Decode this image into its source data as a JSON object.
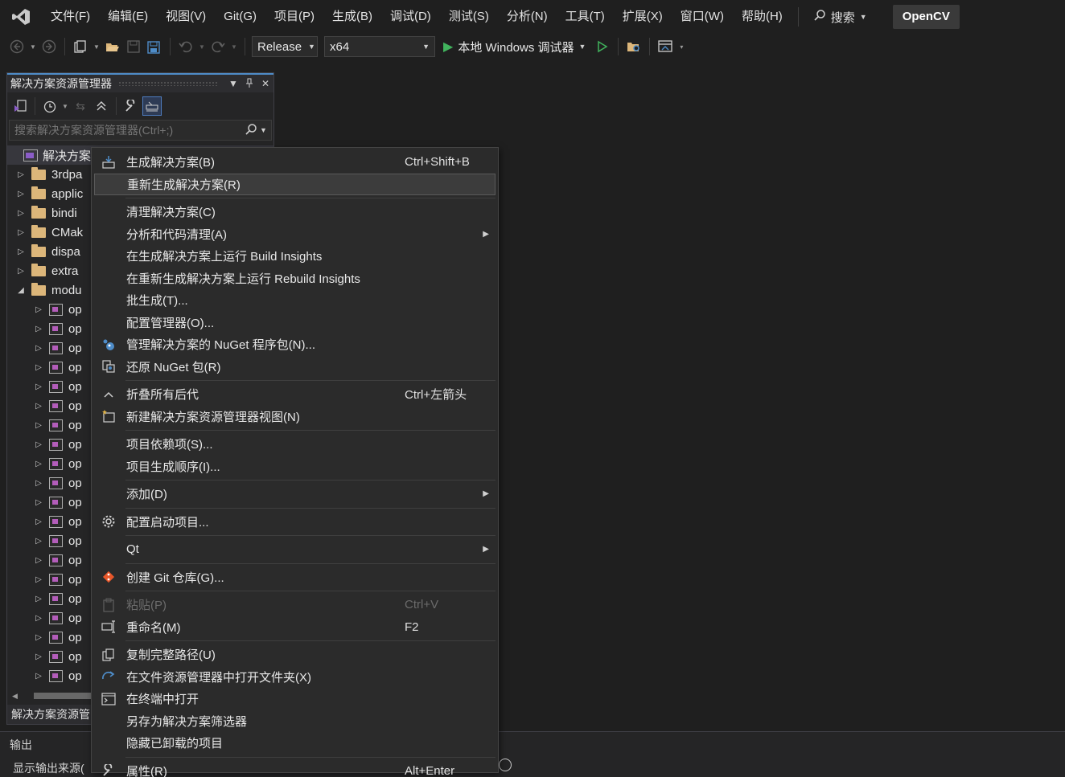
{
  "menubar": {
    "items": [
      "文件(F)",
      "编辑(E)",
      "视图(V)",
      "Git(G)",
      "项目(P)",
      "生成(B)",
      "调试(D)",
      "测试(S)",
      "分析(N)",
      "工具(T)",
      "扩展(X)",
      "窗口(W)",
      "帮助(H)"
    ],
    "search_label": "搜索",
    "solution_name": "OpenCV"
  },
  "toolbar": {
    "configuration": "Release",
    "platform": "x64",
    "run_label": "本地 Windows 调试器"
  },
  "solution_explorer": {
    "title": "解决方案资源管理器",
    "search_placeholder": "搜索解决方案资源管理器(Ctrl+;)",
    "root_label": "解决方案",
    "folders": [
      "3rdpa",
      "applic",
      "bindi",
      "CMak",
      "dispa",
      "extra",
      "modu"
    ],
    "project_label": "op",
    "project_count": 20,
    "bottom_tab": "解决方案资源管"
  },
  "output": {
    "title": "输出",
    "source_label": "显示输出来源("
  },
  "context_menu": {
    "items": [
      {
        "label": "生成解决方案(B)",
        "shortcut": "Ctrl+Shift+B",
        "icon": "build-icon"
      },
      {
        "label": "重新生成解决方案(R)",
        "shortcut": "",
        "highlighted": true
      },
      {
        "label": "清理解决方案(C)",
        "shortcut": ""
      },
      {
        "label": "分析和代码清理(A)",
        "shortcut": "",
        "submenu": true
      },
      {
        "label": "在生成解决方案上运行 Build Insights",
        "shortcut": ""
      },
      {
        "label": "在重新生成解决方案上运行 Rebuild Insights",
        "shortcut": ""
      },
      {
        "label": "批生成(T)...",
        "shortcut": ""
      },
      {
        "label": "配置管理器(O)...",
        "shortcut": ""
      },
      {
        "label": "管理解决方案的 NuGet 程序包(N)...",
        "shortcut": "",
        "icon": "nuget-icon"
      },
      {
        "label": "还原 NuGet 包(R)",
        "shortcut": "",
        "icon": "restore-icon"
      },
      {
        "label": "折叠所有后代",
        "shortcut": "Ctrl+左箭头",
        "icon": "collapse-icon"
      },
      {
        "label": "新建解决方案资源管理器视图(N)",
        "shortcut": "",
        "icon": "new-view-icon"
      },
      {
        "label": "项目依赖项(S)...",
        "shortcut": ""
      },
      {
        "label": "项目生成顺序(I)...",
        "shortcut": ""
      },
      {
        "label": "添加(D)",
        "shortcut": "",
        "submenu": true
      },
      {
        "label": "配置启动项目...",
        "shortcut": "",
        "icon": "gear-icon"
      },
      {
        "label": "Qt",
        "shortcut": "",
        "submenu": true
      },
      {
        "label": "创建 Git 仓库(G)...",
        "shortcut": "",
        "icon": "git-icon"
      },
      {
        "label": "粘贴(P)",
        "shortcut": "Ctrl+V",
        "icon": "paste-icon",
        "disabled": true
      },
      {
        "label": "重命名(M)",
        "shortcut": "F2",
        "icon": "rename-icon"
      },
      {
        "label": "复制完整路径(U)",
        "shortcut": "",
        "icon": "copy-icon"
      },
      {
        "label": "在文件资源管理器中打开文件夹(X)",
        "shortcut": "",
        "icon": "open-folder-icon"
      },
      {
        "label": "在终端中打开",
        "shortcut": "",
        "icon": "terminal-icon"
      },
      {
        "label": "另存为解决方案筛选器",
        "shortcut": ""
      },
      {
        "label": "隐藏已卸载的项目",
        "shortcut": ""
      },
      {
        "label": "属性(R)",
        "shortcut": "Alt+Enter",
        "icon": "wrench-icon"
      }
    ]
  },
  "colors": {
    "background": "#1f1f1f",
    "menu_bg": "#2b2b2b",
    "highlight": "#3c3c3c",
    "accent": "#4e8cc8",
    "run_green": "#41b35d"
  }
}
